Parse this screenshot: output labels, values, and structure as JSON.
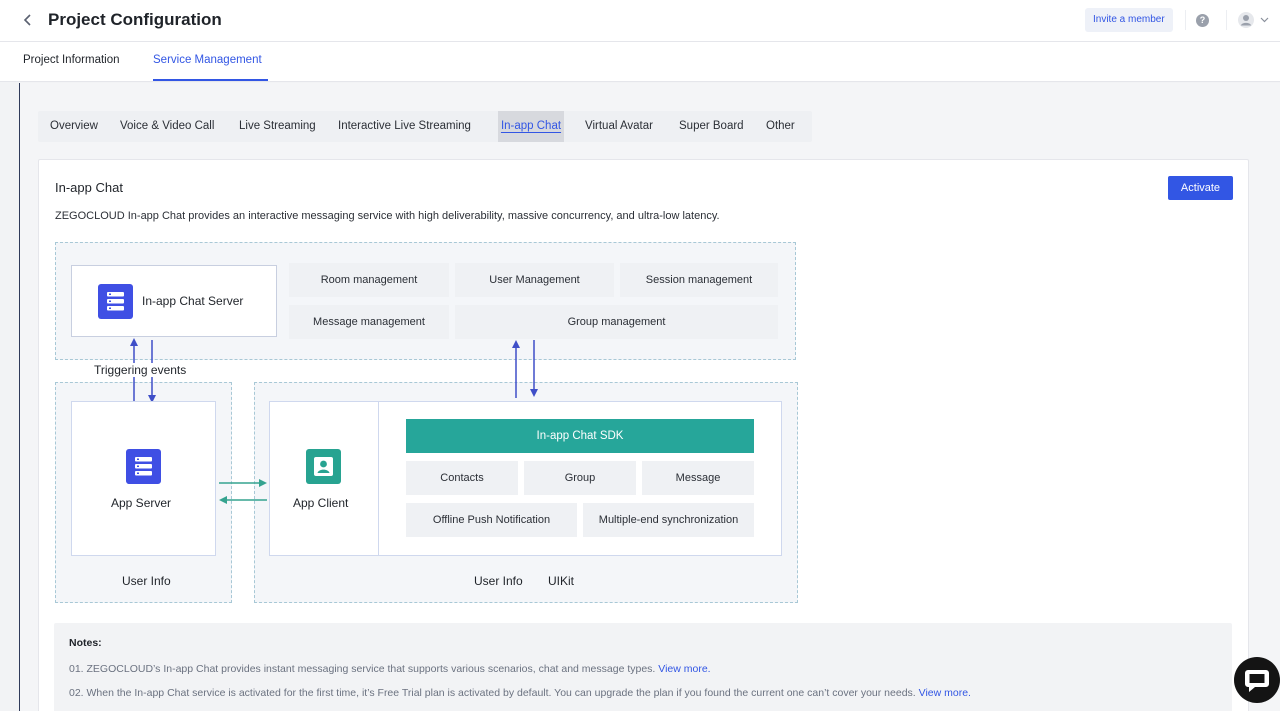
{
  "header": {
    "title": "Project Configuration",
    "invite_label": "Invite a member",
    "help_glyph": "?"
  },
  "main_tabs": [
    {
      "label": "Project Information",
      "active": false
    },
    {
      "label": "Service Management",
      "active": true
    }
  ],
  "sub_tabs": [
    {
      "label": "Overview"
    },
    {
      "label": "Voice & Video Call"
    },
    {
      "label": "Live Streaming"
    },
    {
      "label": "Interactive Live Streaming"
    },
    {
      "label": "In-app Chat",
      "active": true
    },
    {
      "label": "Virtual Avatar"
    },
    {
      "label": "Super Board"
    },
    {
      "label": "Other"
    }
  ],
  "card": {
    "title": "In-app Chat",
    "description": "ZEGOCLOUD In-app Chat provides an interactive messaging service with high deliverability, massive concurrency, and ultra-low latency.",
    "activate_label": "Activate"
  },
  "diagram": {
    "server_label": "In-app Chat Server",
    "server_features": [
      "Room management",
      "User Management",
      "Session management",
      "Message management",
      "Group management"
    ],
    "triggering_label": "Triggering events",
    "app_server_label": "App Server",
    "app_server_footer": "User Info",
    "app_client_label": "App Client",
    "sdk_label": "In-app Chat SDK",
    "sdk_features": [
      "Contacts",
      "Group",
      "Message",
      "Offline Push Notification",
      "Multiple-end synchronization"
    ],
    "client_footer_1": "User Info",
    "client_footer_2": "UIKit"
  },
  "notes": {
    "title": "Notes:",
    "items": [
      {
        "text": "01. ZEGOCLOUD’s In-app Chat provides instant messaging service that supports various scenarios, chat and message types.",
        "link": "View more."
      },
      {
        "text": "02. When the In-app Chat service is activated for the first time, it’s Free Trial plan is activated by default. You can upgrade the plan if you found the current one can’t cover your needs.",
        "link": "View more."
      }
    ]
  },
  "colors": {
    "accent": "#3256e4",
    "sdk_green": "#26a69a",
    "server_blue": "#3f4fe4"
  },
  "icons": [
    "back-icon",
    "help-icon",
    "avatar-icon",
    "chevron-down-icon",
    "server-icon",
    "user-icon",
    "chat-icon"
  ]
}
